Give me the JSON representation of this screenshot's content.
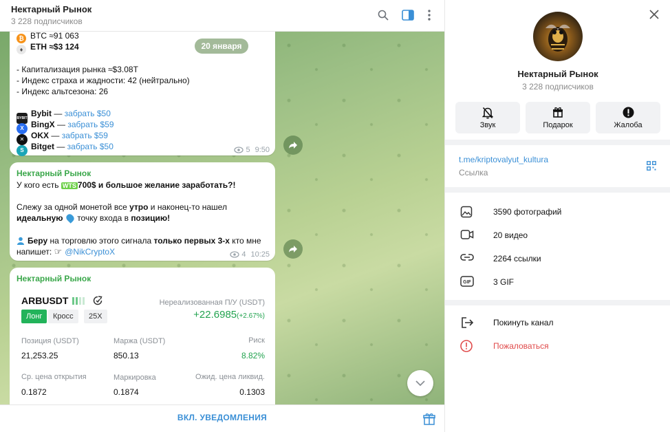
{
  "chat": {
    "title": "Нектарный Рынок",
    "subscribers": "3 228 подписчиков",
    "date_pill": "20 января",
    "footer_button": "ВКЛ. УВЕДОМЛЕНИЯ"
  },
  "messages": [
    {
      "btc": "BTC ≈91 063",
      "eth": "ETH ≈$3 124",
      "cap": "- Капитализация рынка ≈$3.08T",
      "fear": "- Индекс страха и жадности: 42 (нейтрально)",
      "alt": "- Индекс альтсезона: 26",
      "exchanges": [
        {
          "name": "Bybit",
          "dash": " — ",
          "link": "забрать $50",
          "color": "#1c1c1c",
          "short": "BYBIT"
        },
        {
          "name": "BingX",
          "dash": " — ",
          "link": "забрать $59",
          "color": "#2a6ef0",
          "short": "X"
        },
        {
          "name": "OKX",
          "dash": " — ",
          "link": "забрать $59",
          "color": "#111111",
          "short": "✕"
        },
        {
          "name": "Bitget",
          "dash": " — ",
          "link": "забрать $50",
          "color": "#1aa6b7",
          "short": "S"
        }
      ],
      "views": "5",
      "time": "9:50"
    },
    {
      "author": "Нектарный Рынок",
      "l1_a": "У кого есть ",
      "l1_badge": "WTS",
      "l1_b": "700$ и большое желание заработать?!",
      "l2_a": "Слежу за одной монетой все ",
      "l2_b": "утро",
      "l2_c": " и наконец-то нашел",
      "l3_a": "идеальную",
      "l3_b": " точку входа в ",
      "l3_c": "позицию!",
      "l4_a": "Беру",
      "l4_b": " на торговлю этого сигнала ",
      "l4_c": "только первых 3-х",
      "l4_d": " кто мне",
      "l5_a": "напишет: ",
      "l5_link": "@NikCryptoX",
      "views": "4",
      "time": "10:25"
    },
    {
      "author": "Нектарный Рынок",
      "pair": "ARBUSDT",
      "tag_long": "Лонг",
      "tag_cross": "Кросс",
      "tag_lev": "25X",
      "pnl_label": "Нереализованная П/У (USDT)",
      "pnl_value": "+22.6985",
      "pnl_pct": "(+2.67%)",
      "pos_label": "Позиция (USDT)",
      "pos_value": "21,253.25",
      "margin_label": "Маржа (USDT)",
      "margin_value": "850.13",
      "risk_label": "Риск",
      "risk_value": "8.82%",
      "open_label": "Ср. цена открытия",
      "open_value": "0.1872",
      "mark_label": "Маркировка",
      "mark_value": "0.1874",
      "liq_label": "Ожид. цена ликвид.",
      "liq_value": "0.1303"
    }
  ],
  "profile": {
    "name": "Нектарный Рынок",
    "subscribers": "3 228 подписчиков",
    "actions": [
      {
        "label": "Звук",
        "icon": "bell-off-icon"
      },
      {
        "label": "Подарок",
        "icon": "gift-icon"
      },
      {
        "label": "Жалоба",
        "icon": "alert-icon"
      }
    ],
    "link": "t.me/kriptovalyut_kultura",
    "link_caption": "Ссылка",
    "media": [
      {
        "label": "3590 фотографий",
        "icon": "photo-icon"
      },
      {
        "label": "20 видео",
        "icon": "video-icon"
      },
      {
        "label": "2264 ссылки",
        "icon": "link-icon"
      },
      {
        "label": "3 GIF",
        "icon": "gif-icon"
      }
    ],
    "leave": "Покинуть канал",
    "report": "Пожаловаться"
  },
  "colors": {
    "accent": "#3a8fd6",
    "author": "#3aa74a",
    "danger": "#e04a4a",
    "profit": "#22a34f"
  }
}
